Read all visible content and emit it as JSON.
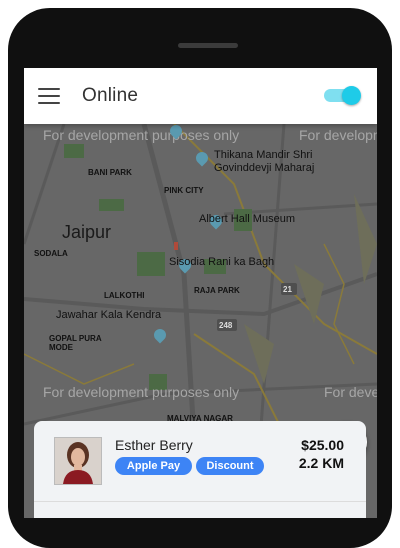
{
  "header": {
    "title": "Online",
    "online_toggle": true
  },
  "map": {
    "city_label": "Jaipur",
    "watermark": "For development purposes only",
    "places": [
      {
        "id": "thikana",
        "label_line1": "Thikana Mandir Shri",
        "label_line2": "Govinddevji Maharaj"
      },
      {
        "id": "albert-hall",
        "label": "Albert Hall Museum"
      },
      {
        "id": "sisodia",
        "label": "Sisodia Rani ka Bagh"
      },
      {
        "id": "jawahar",
        "label": "Jawahar Kala Kendra"
      }
    ],
    "areas": [
      "BANI PARK",
      "PINK CITY",
      "SODALA",
      "LALKOTHI",
      "RAJA PARK",
      "GOPAL PURA MODE",
      "MALVIYA NAGAR"
    ],
    "road_shields": [
      "21",
      "248"
    ]
  },
  "ride_card": {
    "customer_name": "Esther Berry",
    "tags": [
      "Apple Pay",
      "Discount"
    ],
    "fare": "$25.00",
    "distance": "2.2 KM"
  },
  "colors": {
    "accent": "#1ecbe8",
    "chip": "#3d84f5",
    "map_background": "#676767"
  },
  "icons": {
    "menu": "hamburger-menu-icon",
    "locate": "my-location-icon"
  }
}
